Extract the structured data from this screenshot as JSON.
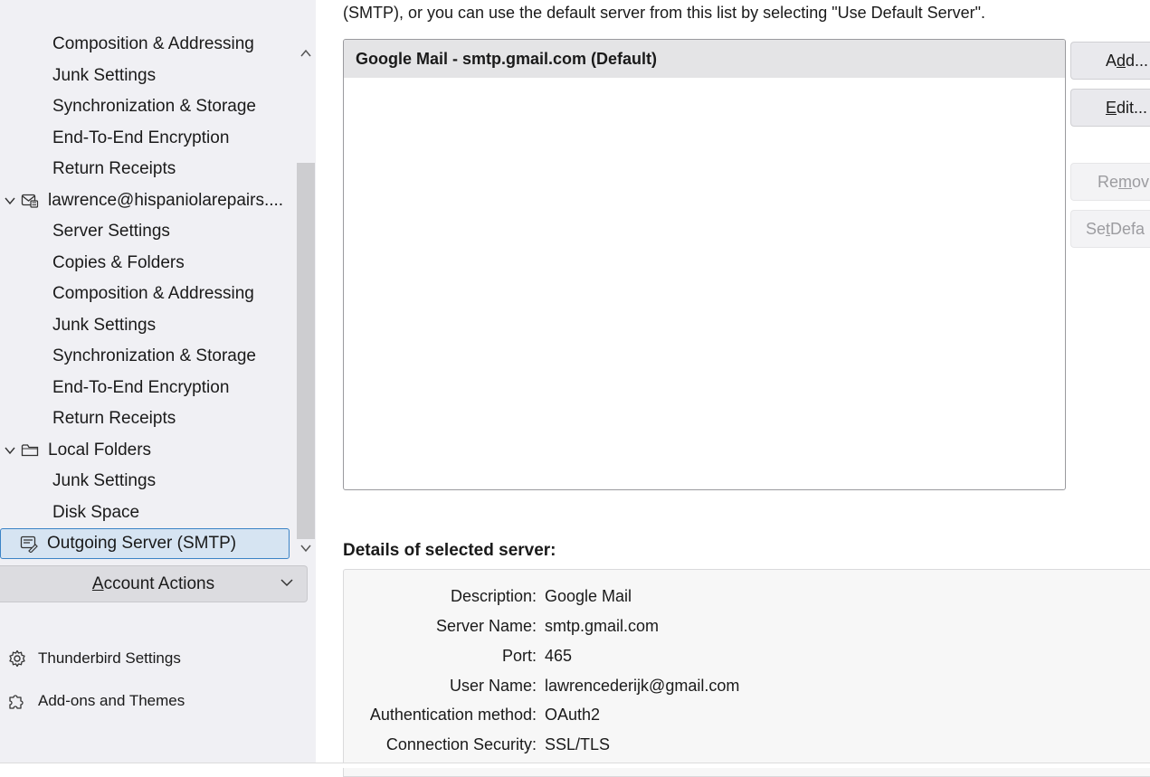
{
  "sidebar": {
    "tree": [
      {
        "label": "Composition & Addressing",
        "kind": "child",
        "partial": true
      },
      {
        "label": "Junk Settings",
        "kind": "child"
      },
      {
        "label": "Synchronization & Storage",
        "kind": "child"
      },
      {
        "label": "End-To-End Encryption",
        "kind": "child"
      },
      {
        "label": "Return Receipts",
        "kind": "child"
      },
      {
        "label": "lawrence@hispaniolarepairs....",
        "kind": "account",
        "icon": "mail-account-icon"
      },
      {
        "label": "Server Settings",
        "kind": "child"
      },
      {
        "label": "Copies & Folders",
        "kind": "child"
      },
      {
        "label": "Composition & Addressing",
        "kind": "child"
      },
      {
        "label": "Junk Settings",
        "kind": "child"
      },
      {
        "label": "Synchronization & Storage",
        "kind": "child"
      },
      {
        "label": "End-To-End Encryption",
        "kind": "child"
      },
      {
        "label": "Return Receipts",
        "kind": "child"
      },
      {
        "label": "Local Folders",
        "kind": "account",
        "icon": "folder-icon"
      },
      {
        "label": "Junk Settings",
        "kind": "child"
      },
      {
        "label": "Disk Space",
        "kind": "child"
      },
      {
        "label": "Outgoing Server (SMTP)",
        "kind": "selected",
        "icon": "outgoing-server-icon"
      }
    ],
    "account_actions": {
      "pre": "",
      "accel": "A",
      "post": "ccount Actions"
    },
    "links": {
      "settings": "Thunderbird Settings",
      "addons": "Add-ons and Themes"
    }
  },
  "main": {
    "intro": "(SMTP), or you can use the default server from this list by selecting \"Use Default Server\".",
    "servers": [
      "Google Mail - smtp.gmail.com (Default)"
    ],
    "buttons": {
      "add": {
        "pre": "A",
        "accel": "d",
        "post": "d..."
      },
      "edit": {
        "pre": "",
        "accel": "E",
        "post": "dit..."
      },
      "remove": {
        "pre": "Re",
        "accel": "m",
        "post": "ov"
      },
      "set_default": {
        "pre": "Se",
        "accel": "t",
        "post": " Defa"
      }
    },
    "details_heading": "Details of selected server:",
    "details": [
      {
        "label": "Description:",
        "value": "Google Mail"
      },
      {
        "label": "Server Name:",
        "value": "smtp.gmail.com"
      },
      {
        "label": "Port:",
        "value": "465"
      },
      {
        "label": "User Name:",
        "value": "lawrencederijk@gmail.com"
      },
      {
        "label": "Authentication method:",
        "value": "OAuth2"
      },
      {
        "label": "Connection Security:",
        "value": "SSL/TLS"
      }
    ]
  },
  "colors": {
    "selection_bg": "#d6e4f2",
    "selection_border": "#3b83c6",
    "sidebar_bg": "#f0f0f4"
  }
}
